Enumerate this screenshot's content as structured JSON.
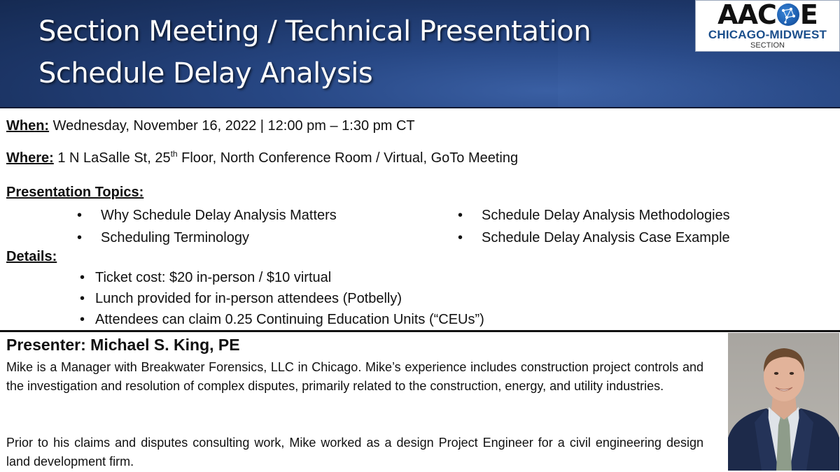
{
  "header": {
    "title_line1": "Section Meeting / Technical Presentation",
    "title_line2": "Schedule Delay Analysis",
    "background_color": "#1f3c73"
  },
  "logo": {
    "mark_left": "AAC",
    "mark_right": "E",
    "icon": "globe-icon",
    "subtitle": "CHICAGO-MIDWEST",
    "section": "SECTION",
    "subtitle_color": "#1b4f8c"
  },
  "event": {
    "when_label": "When:",
    "when_value": "Wednesday, November 16, 2022 | 12:00 pm – 1:30 pm CT",
    "where_label": "Where:",
    "where_value_pre": "1 N LaSalle St, 25",
    "where_value_sup": "th",
    "where_value_post": " Floor, North Conference Room / Virtual, GoTo Meeting"
  },
  "topics": {
    "heading": "Presentation Topics:",
    "bullet": "•",
    "items": [
      "Why Schedule Delay Analysis Matters",
      "Scheduling Terminology",
      "Schedule Delay Analysis Methodologies",
      "Schedule Delay Analysis Case Example"
    ]
  },
  "details": {
    "heading": "Details:",
    "bullet": "•",
    "items": [
      "Ticket cost: $20 in-person / $10 virtual",
      "Lunch provided for in-person attendees (Potbelly)",
      "Attendees can claim 0.25 Continuing Education Units (“CEUs”)"
    ]
  },
  "presenter": {
    "heading": "Presenter: Michael S. King, PE",
    "bio_paragraph1": "Mike is a Manager with Breakwater Forensics, LLC in Chicago. Mike’s experience includes construction project controls and the investigation and resolution of complex disputes, primarily related to the construction, energy, and utility industries.",
    "bio_paragraph2": "Prior to his claims and disputes consulting work, Mike worked as a design Project Engineer for a civil engineering design land development firm.",
    "photo": "presenter-headshot"
  }
}
